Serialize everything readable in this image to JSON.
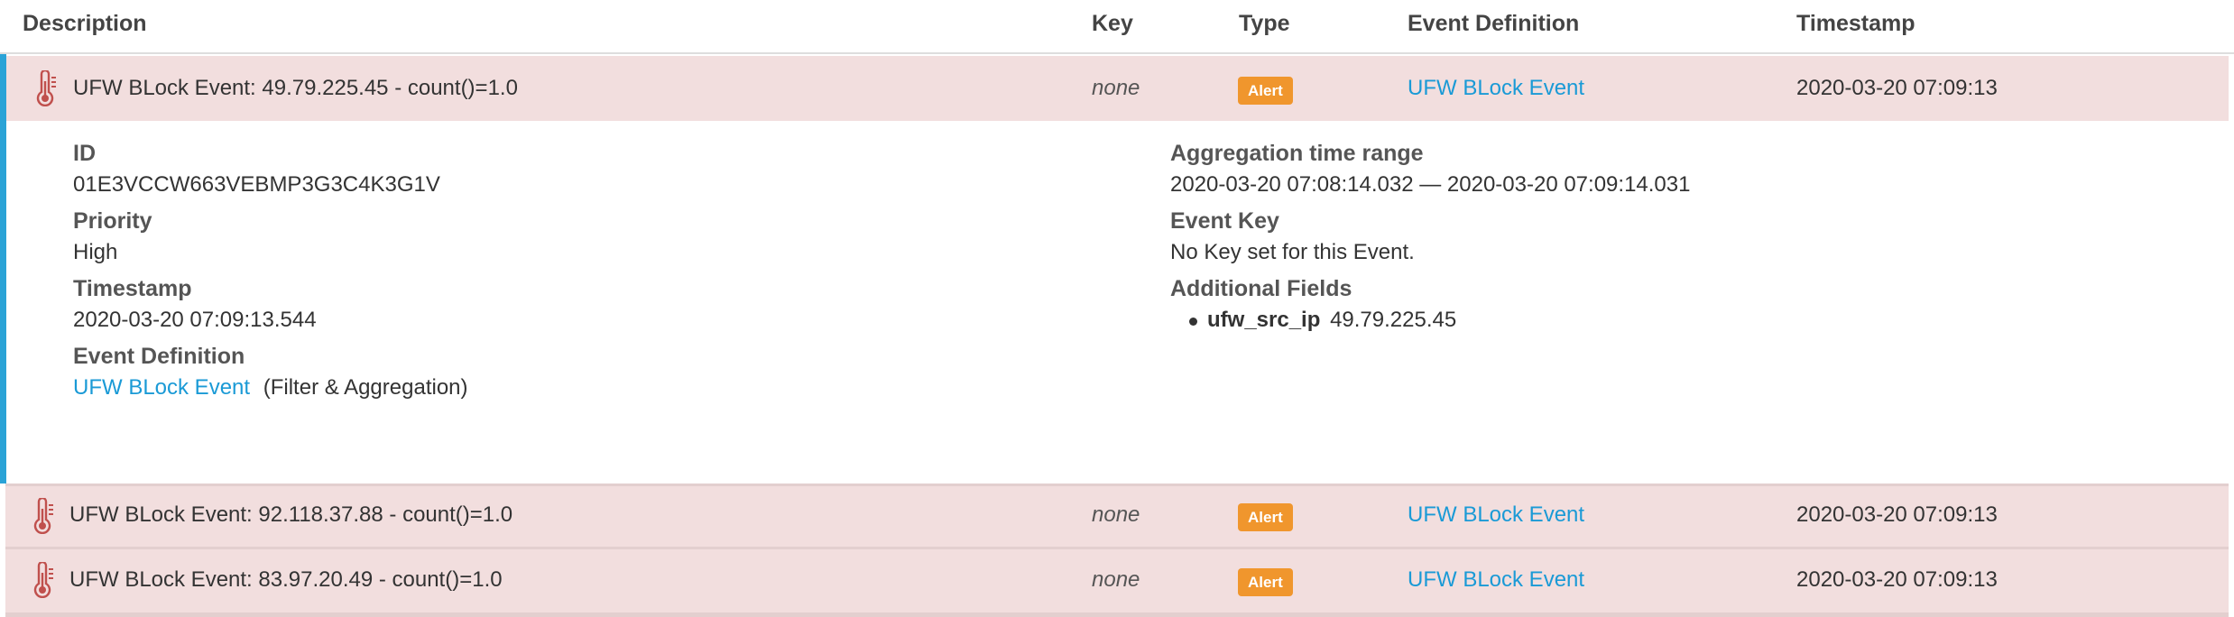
{
  "headers": {
    "description": "Description",
    "key": "Key",
    "type": "Type",
    "event_definition": "Event Definition",
    "timestamp": "Timestamp"
  },
  "rows": [
    {
      "description": "UFW BLock Event: 49.79.225.45 - count()=1.0",
      "key": "none",
      "type": "Alert",
      "event_definition": "UFW BLock Event",
      "timestamp": "2020-03-20 07:09:13"
    },
    {
      "description": "UFW BLock Event: 92.118.37.88 - count()=1.0",
      "key": "none",
      "type": "Alert",
      "event_definition": "UFW BLock Event",
      "timestamp": "2020-03-20 07:09:13"
    },
    {
      "description": "UFW BLock Event: 83.97.20.49 - count()=1.0",
      "key": "none",
      "type": "Alert",
      "event_definition": "UFW BLock Event",
      "timestamp": "2020-03-20 07:09:13"
    }
  ],
  "details": {
    "id_label": "ID",
    "id_value": "01E3VCCW663VEBMP3G3C4K3G1V",
    "priority_label": "Priority",
    "priority_value": "High",
    "timestamp_label": "Timestamp",
    "timestamp_value": "2020-03-20 07:09:13.544",
    "event_definition_label": "Event Definition",
    "event_definition_link": "UFW BLock Event",
    "event_definition_type": "(Filter & Aggregation)",
    "aggregation_label": "Aggregation time range",
    "aggregation_value": "2020-03-20 07:08:14.032 — 2020-03-20 07:09:14.031",
    "event_key_label": "Event Key",
    "event_key_value": "No Key set for this Event.",
    "additional_fields_label": "Additional Fields",
    "fields": [
      {
        "name": "ufw_src_ip",
        "value": "49.79.225.45"
      }
    ]
  },
  "colors": {
    "row_bg": "#f2dede",
    "accent": "#2aa3d7",
    "badge": "#f0962d",
    "link": "#1a9ad6",
    "icon": "#c0504d"
  },
  "icons": {
    "event_icon": "thermometer-icon"
  }
}
